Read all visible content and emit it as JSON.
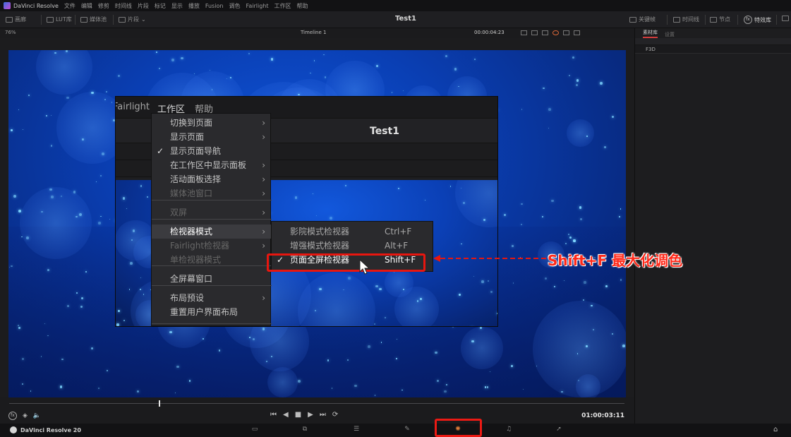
{
  "app": {
    "name": "DaVinci Resolve"
  },
  "menubar": {
    "items": [
      "文件",
      "编辑",
      "修剪",
      "时间线",
      "片段",
      "标记",
      "显示",
      "播放",
      "Fusion",
      "调色",
      "Fairlight",
      "工作区",
      "帮助"
    ]
  },
  "toolbar": {
    "media_pool": "画廊",
    "luts": "LUT库",
    "media_bin": "媒体池",
    "clips": "片段",
    "project_title": "Test1",
    "keyframes": "关键帧",
    "timeline": "时间线",
    "nodes": "节点",
    "effects": "特效库"
  },
  "viewer": {
    "zoom": "76%",
    "timeline_name": "Timeline 1",
    "timecode": "00:00:04:23"
  },
  "right_panel": {
    "tabs": [
      "素材库",
      "设置"
    ],
    "bin_name": "F3D"
  },
  "inner_window": {
    "menu": [
      "Fairlight",
      "工作区",
      "帮助"
    ],
    "title": "Test1"
  },
  "workspace_menu": {
    "items": [
      {
        "label": "切换到页面",
        "submenu": true
      },
      {
        "label": "显示页面",
        "submenu": true
      },
      {
        "label": "显示页面导航",
        "checked": true
      },
      {
        "label": "在工作区中显示面板",
        "submenu": true
      },
      {
        "label": "活动面板选择",
        "submenu": true
      },
      {
        "label": "媒体池窗口",
        "submenu": true,
        "disabled": true
      },
      {
        "label": "双屏",
        "submenu": true,
        "disabled": true
      },
      {
        "label": "检视器模式",
        "submenu": true,
        "highlighted": true
      },
      {
        "label": "Fairlight检视器",
        "submenu": true,
        "disabled": true
      },
      {
        "label": "单检视器模式",
        "disabled": true
      },
      {
        "label": "全屏幕窗口"
      },
      {
        "label": "布局预设",
        "submenu": true
      },
      {
        "label": "重置用户界面布局"
      }
    ]
  },
  "viewer_mode_menu": {
    "items": [
      {
        "label": "影院模式检视器",
        "shortcut": "Ctrl+F"
      },
      {
        "label": "增强模式检视器",
        "shortcut": "Alt+F"
      },
      {
        "label": "页面全屏检视器",
        "shortcut": "Shift+F",
        "checked": true
      }
    ]
  },
  "annotation": {
    "text": "Shift+F 最大化调色",
    "color": "#ff2a1a"
  },
  "transport": {
    "timecode": "01:00:03:11"
  },
  "pagebar": {
    "brand": "DaVinci Resolve 20",
    "active_page": "color",
    "accent": "#e07e3a"
  }
}
